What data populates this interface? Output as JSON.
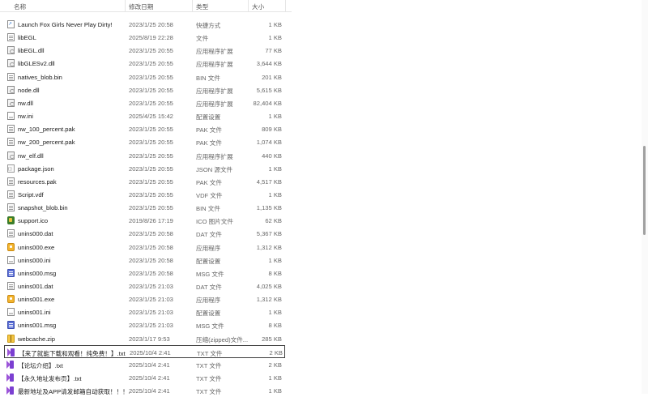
{
  "columns": {
    "name": "名称",
    "date": "修改日期",
    "type": "类型",
    "size": "大小"
  },
  "files": [
    {
      "name": "Launch Fox Girls Never Play Dirty!",
      "date": "2023/1/25 20:58",
      "type": "快捷方式",
      "size": "1 KB",
      "icon": "shortcut-icon"
    },
    {
      "name": "libEGL",
      "date": "2025/8/19 22:28",
      "type": "文件",
      "size": "1 KB",
      "icon": "file-icon"
    },
    {
      "name": "libEGL.dll",
      "date": "2023/1/25 20:55",
      "type": "应用程序扩展",
      "size": "77 KB",
      "icon": "dll-icon"
    },
    {
      "name": "libGLESv2.dll",
      "date": "2023/1/25 20:55",
      "type": "应用程序扩展",
      "size": "3,644 KB",
      "icon": "dll-icon"
    },
    {
      "name": "natives_blob.bin",
      "date": "2023/1/25 20:55",
      "type": "BIN 文件",
      "size": "201 KB",
      "icon": "file-icon"
    },
    {
      "name": "node.dll",
      "date": "2023/1/25 20:55",
      "type": "应用程序扩展",
      "size": "5,615 KB",
      "icon": "dll-icon"
    },
    {
      "name": "nw.dll",
      "date": "2023/1/25 20:55",
      "type": "应用程序扩展",
      "size": "82,404 KB",
      "icon": "dll-icon"
    },
    {
      "name": "nw.ini",
      "date": "2025/4/25 15:42",
      "type": "配置设置",
      "size": "1 KB",
      "icon": "config-icon"
    },
    {
      "name": "nw_100_percent.pak",
      "date": "2023/1/25 20:55",
      "type": "PAK 文件",
      "size": "809 KB",
      "icon": "file-icon"
    },
    {
      "name": "nw_200_percent.pak",
      "date": "2023/1/25 20:55",
      "type": "PAK 文件",
      "size": "1,074 KB",
      "icon": "file-icon"
    },
    {
      "name": "nw_elf.dll",
      "date": "2023/1/25 20:55",
      "type": "应用程序扩展",
      "size": "440 KB",
      "icon": "dll-icon"
    },
    {
      "name": "package.json",
      "date": "2023/1/25 20:55",
      "type": "JSON 源文件",
      "size": "1 KB",
      "icon": "json-icon"
    },
    {
      "name": "resources.pak",
      "date": "2023/1/25 20:55",
      "type": "PAK 文件",
      "size": "4,517 KB",
      "icon": "file-icon"
    },
    {
      "name": "Script.vdf",
      "date": "2023/1/25 20:55",
      "type": "VDF 文件",
      "size": "1 KB",
      "icon": "file-icon"
    },
    {
      "name": "snapshot_blob.bin",
      "date": "2023/1/25 20:55",
      "type": "BIN 文件",
      "size": "1,135 KB",
      "icon": "file-icon"
    },
    {
      "name": "support.ico",
      "date": "2019/8/26 17:19",
      "type": "ICO 图片文件",
      "size": "62 KB",
      "icon": "image-icon"
    },
    {
      "name": "unins000.dat",
      "date": "2023/1/25 20:58",
      "type": "DAT 文件",
      "size": "5,367 KB",
      "icon": "file-icon"
    },
    {
      "name": "unins000.exe",
      "date": "2023/1/25 20:58",
      "type": "应用程序",
      "size": "1,312 KB",
      "icon": "exe-icon"
    },
    {
      "name": "unins000.ini",
      "date": "2023/1/25 20:58",
      "type": "配置设置",
      "size": "1 KB",
      "icon": "config-icon"
    },
    {
      "name": "unins000.msg",
      "date": "2023/1/25 20:58",
      "type": "MSG 文件",
      "size": "8 KB",
      "icon": "msg-icon"
    },
    {
      "name": "unins001.dat",
      "date": "2023/1/25 21:03",
      "type": "DAT 文件",
      "size": "4,025 KB",
      "icon": "file-icon"
    },
    {
      "name": "unins001.exe",
      "date": "2023/1/25 21:03",
      "type": "应用程序",
      "size": "1,312 KB",
      "icon": "exe-icon"
    },
    {
      "name": "unins001.ini",
      "date": "2023/1/25 21:03",
      "type": "配置设置",
      "size": "1 KB",
      "icon": "config-icon"
    },
    {
      "name": "unins001.msg",
      "date": "2023/1/25 21:03",
      "type": "MSG 文件",
      "size": "8 KB",
      "icon": "msg-icon"
    },
    {
      "name": "webcache.zip",
      "date": "2023/1/17 9:53",
      "type": "压缩(zipped)文件...",
      "size": "285 KB",
      "icon": "zip-icon"
    },
    {
      "name": "【来了就能下载和观看！纯免费！】.txt",
      "date": "2025/10/4 2:41",
      "type": "TXT 文件",
      "size": "2 KB",
      "icon": "visual-studio-icon",
      "selected": true
    },
    {
      "name": "【论坛介绍】.txt",
      "date": "2025/10/4 2:41",
      "type": "TXT 文件",
      "size": "2 KB",
      "icon": "visual-studio-icon"
    },
    {
      "name": "【永久地址发布页】.txt",
      "date": "2025/10/4 2:41",
      "type": "TXT 文件",
      "size": "1 KB",
      "icon": "visual-studio-icon"
    },
    {
      "name": "最新地址及APP请发邮箱自动获取！！！...",
      "date": "2025/10/4 2:41",
      "type": "TXT 文件",
      "size": "1 KB",
      "icon": "visual-studio-icon"
    }
  ]
}
